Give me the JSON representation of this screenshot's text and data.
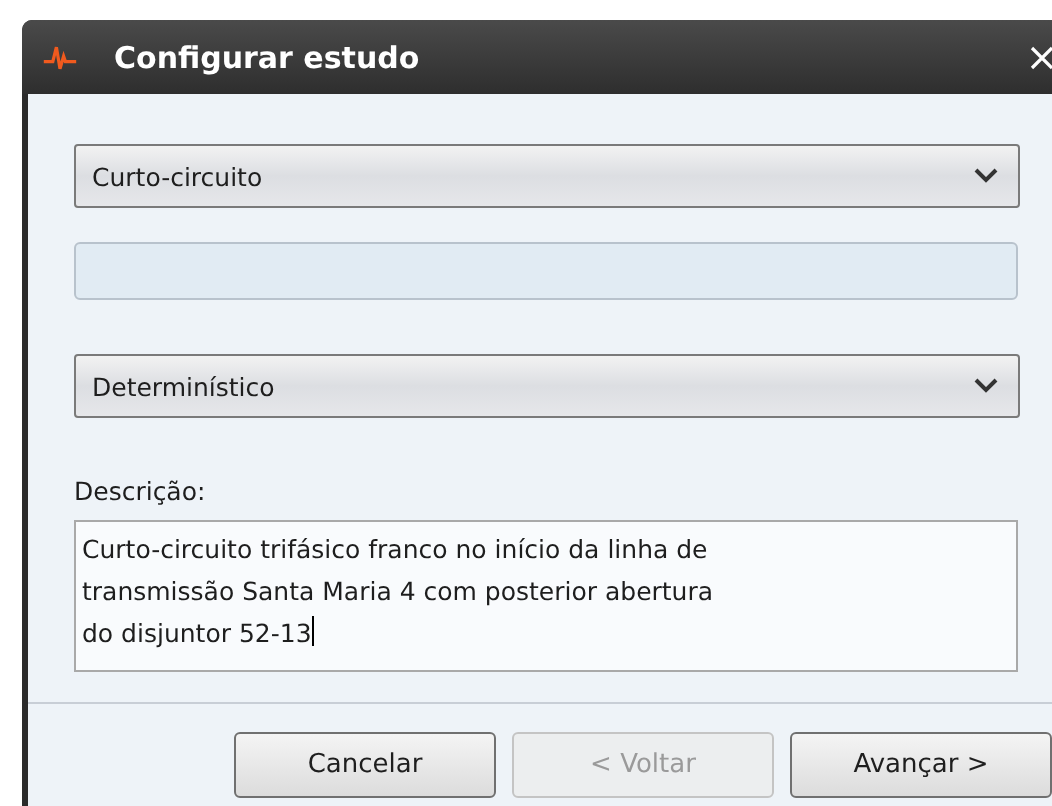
{
  "window": {
    "title": "Configurar estudo"
  },
  "study_type": {
    "value": "Curto-circuito"
  },
  "name_field": {
    "disabled": true
  },
  "mode": {
    "value": "Determinístico"
  },
  "description": {
    "label": "Descrição:",
    "value": "Curto-circuito trifásico franco no início da linha de\ntransmissão Santa Maria 4 com posterior abertura\ndo disjuntor 52-13",
    "focused": true
  },
  "buttons": [
    {
      "label": "Cancelar",
      "disabled": false
    },
    {
      "label": "< Voltar",
      "disabled": true
    },
    {
      "label": "Avançar >",
      "disabled": false
    }
  ]
}
